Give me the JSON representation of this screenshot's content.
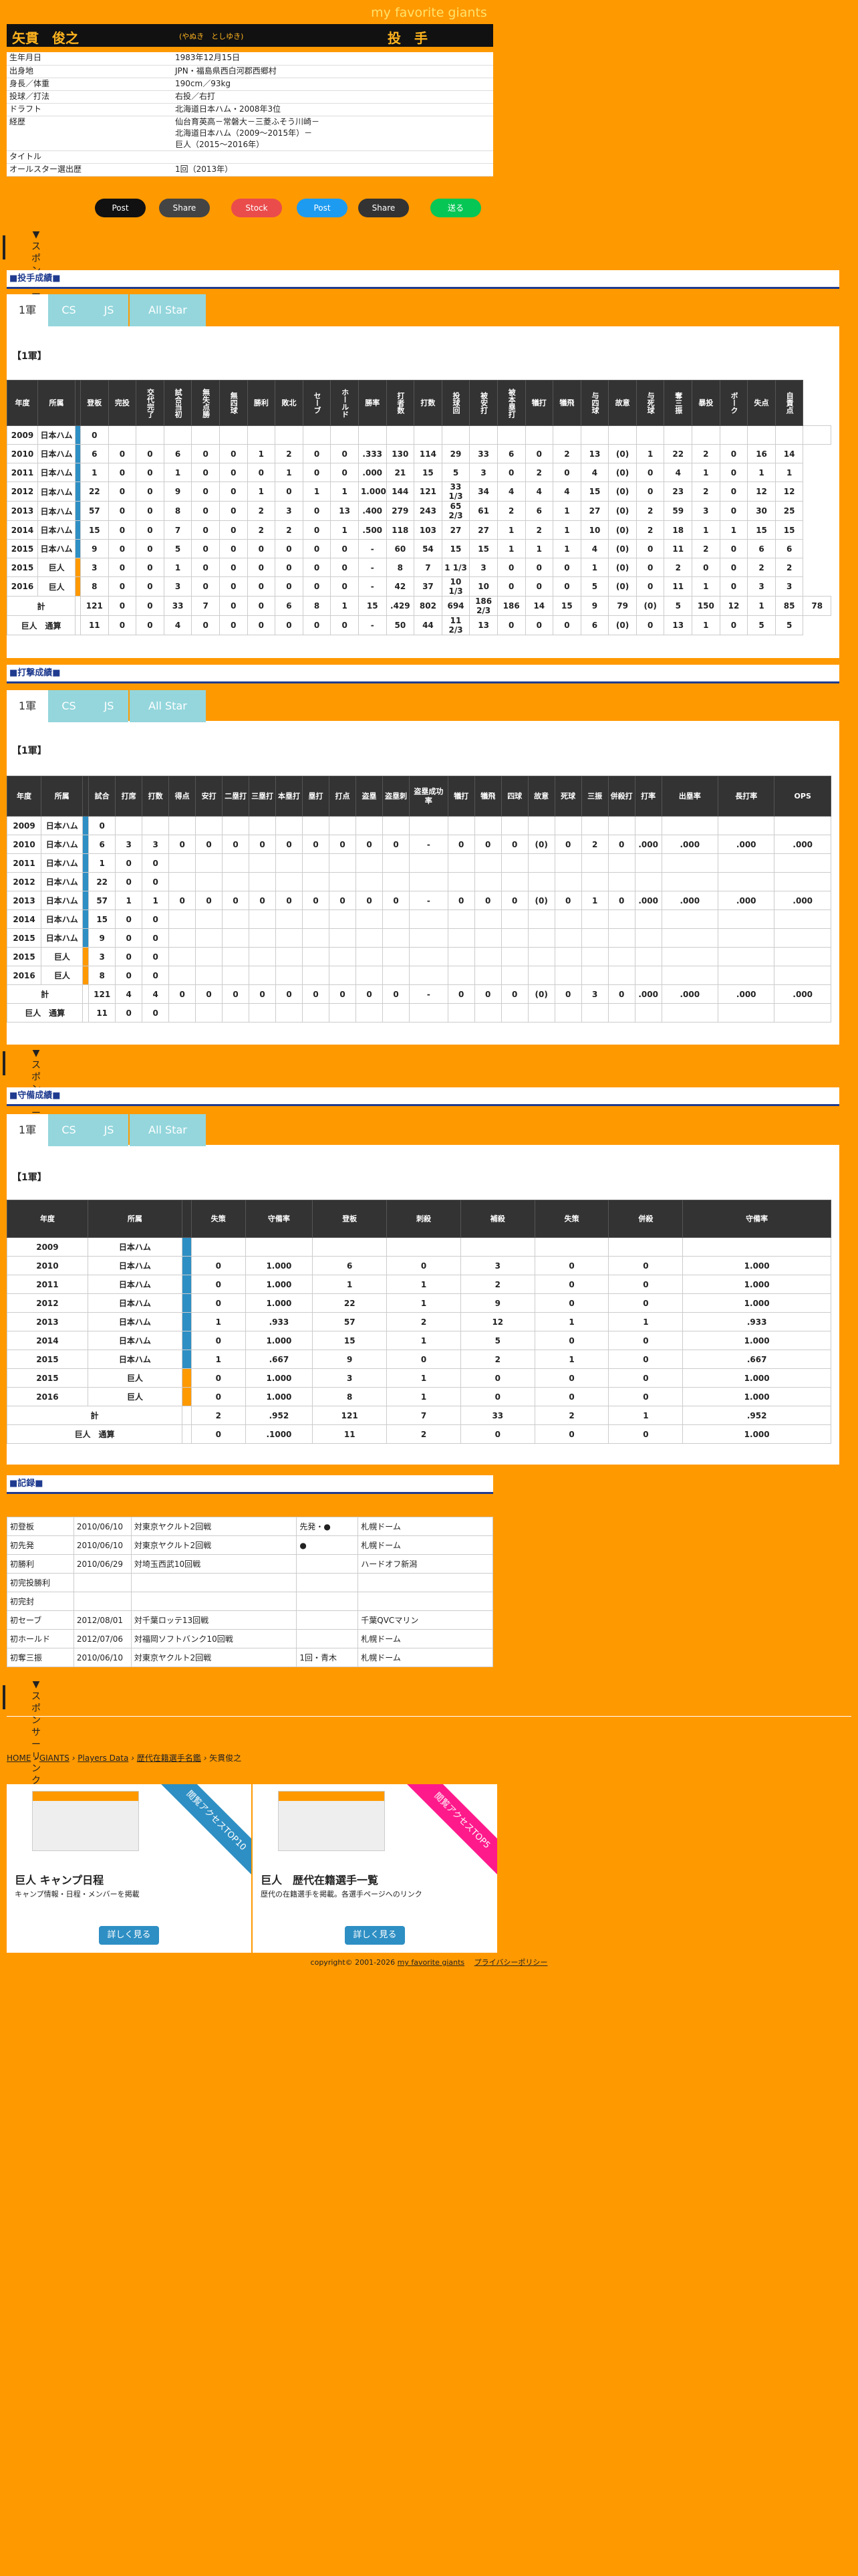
{
  "site_title": "my favorite giants",
  "player": {
    "name": "矢貫　俊之",
    "kana": "(やぬき　としゆき)",
    "position": "投　手"
  },
  "profile": [
    [
      "生年月日",
      "1983年12月15日"
    ],
    [
      "出身地",
      "JPN・福島県西白河郡西郷村"
    ],
    [
      "身長／体重",
      "190cm／93kg"
    ],
    [
      "投球／打法",
      "右投／右打"
    ],
    [
      "ドラフト",
      "北海道日本ハム・2008年3位"
    ],
    [
      "経歴",
      "仙台育英高－常磐大－三菱ふそう川崎－\n北海道日本ハム（2009～2015年）－\n巨人（2015～2016年）"
    ],
    [
      "タイトル",
      ""
    ],
    [
      "オールスター選出歴",
      "1回（2013年）"
    ]
  ],
  "share": [
    "Post",
    "Share",
    "Stock",
    "Post",
    "Share",
    "送る"
  ],
  "sponsor": "▼スポンサーリンク",
  "sections": {
    "pitching": "■投手成績■",
    "batting": "■打撃成績■",
    "fielding": "■守備成績■",
    "record": "■記録■"
  },
  "tabs": [
    "1軍",
    "CS",
    "JS",
    "All Star"
  ],
  "tier_label": "【1軍】",
  "pitch_headers": [
    "年度",
    "所属",
    "",
    "登板",
    "完投",
    "交代完了",
    "試合当初",
    "無失点勝",
    "無四球",
    "勝利",
    "敗北",
    "セーブ",
    "ホールド",
    "勝率",
    "打者数",
    "打数",
    "投球回",
    "被安打",
    "被本塁打",
    "犠打",
    "犠飛",
    "与四球",
    "故意",
    "与死球",
    "奪三振",
    "暴投",
    "ボーク",
    "失点",
    "自責点"
  ],
  "pitch_rows": [
    [
      "2009",
      "日本ハム",
      "0",
      "",
      "",
      "",
      "",
      "",
      "",
      "",
      "",
      "",
      "",
      "",
      "",
      "",
      "",
      "",
      "",
      "",
      "",
      "",
      "",
      "",
      "",
      "",
      "",
      "",
      ""
    ],
    [
      "2010",
      "日本ハム",
      "6",
      "0",
      "0",
      "6",
      "0",
      "0",
      "1",
      "2",
      "0",
      "0",
      ".333",
      "130",
      "114",
      "29",
      "33",
      "6",
      "0",
      "2",
      "13",
      "(0)",
      "1",
      "22",
      "2",
      "0",
      "16",
      "14"
    ],
    [
      "2011",
      "日本ハム",
      "1",
      "0",
      "0",
      "1",
      "0",
      "0",
      "0",
      "1",
      "0",
      "0",
      ".000",
      "21",
      "15",
      "5",
      "3",
      "0",
      "2",
      "0",
      "4",
      "(0)",
      "0",
      "4",
      "1",
      "0",
      "1",
      "1"
    ],
    [
      "2012",
      "日本ハム",
      "22",
      "0",
      "0",
      "9",
      "0",
      "0",
      "1",
      "0",
      "1",
      "1",
      "1.000",
      "144",
      "121",
      "33 1/3",
      "34",
      "4",
      "4",
      "4",
      "15",
      "(0)",
      "0",
      "23",
      "2",
      "0",
      "12",
      "12"
    ],
    [
      "2013",
      "日本ハム",
      "57",
      "0",
      "0",
      "8",
      "0",
      "0",
      "2",
      "3",
      "0",
      "13",
      ".400",
      "279",
      "243",
      "65 2/3",
      "61",
      "2",
      "6",
      "1",
      "27",
      "(0)",
      "2",
      "59",
      "3",
      "0",
      "30",
      "25"
    ],
    [
      "2014",
      "日本ハム",
      "15",
      "0",
      "0",
      "7",
      "0",
      "0",
      "2",
      "2",
      "0",
      "1",
      ".500",
      "118",
      "103",
      "27",
      "27",
      "1",
      "2",
      "1",
      "10",
      "(0)",
      "2",
      "18",
      "1",
      "1",
      "15",
      "15"
    ],
    [
      "2015",
      "日本ハム",
      "9",
      "0",
      "0",
      "5",
      "0",
      "0",
      "0",
      "0",
      "0",
      "0",
      "-",
      "60",
      "54",
      "15",
      "15",
      "1",
      "1",
      "1",
      "4",
      "(0)",
      "0",
      "11",
      "2",
      "0",
      "6",
      "6"
    ],
    [
      "2015",
      "巨人",
      "3",
      "0",
      "0",
      "1",
      "0",
      "0",
      "0",
      "0",
      "0",
      "0",
      "-",
      "8",
      "7",
      "1 1/3",
      "3",
      "0",
      "0",
      "0",
      "1",
      "(0)",
      "0",
      "2",
      "0",
      "0",
      "2",
      "2"
    ],
    [
      "2016",
      "巨人",
      "8",
      "0",
      "0",
      "3",
      "0",
      "0",
      "0",
      "0",
      "0",
      "0",
      "-",
      "42",
      "37",
      "10 1/3",
      "10",
      "0",
      "0",
      "0",
      "5",
      "(0)",
      "0",
      "11",
      "1",
      "0",
      "3",
      "3"
    ],
    [
      "計",
      "",
      "121",
      "0",
      "0",
      "33",
      "7",
      "0",
      "0",
      "6",
      "8",
      "1",
      "15",
      ".429",
      "802",
      "694",
      "186 2/3",
      "186",
      "14",
      "15",
      "9",
      "79",
      "(0)",
      "5",
      "150",
      "12",
      "1",
      "85",
      "78"
    ],
    [
      "巨人　通算",
      "",
      "11",
      "0",
      "0",
      "4",
      "0",
      "0",
      "0",
      "0",
      "0",
      "0",
      "-",
      "50",
      "44",
      "11 2/3",
      "13",
      "0",
      "0",
      "0",
      "6",
      "(0)",
      "0",
      "13",
      "1",
      "0",
      "5",
      "5"
    ]
  ],
  "bat_headers": [
    "年度",
    "所属",
    "",
    "試合",
    "打席",
    "打数",
    "得点",
    "安打",
    "二塁打",
    "三塁打",
    "本塁打",
    "塁打",
    "打点",
    "盗塁",
    "盗塁刺",
    "盗塁成功率",
    "犠打",
    "犠飛",
    "四球",
    "故意",
    "死球",
    "三振",
    "併殺打",
    "打率",
    "出塁率",
    "長打率",
    "OPS"
  ],
  "bat_rows": [
    [
      "2009",
      "日本ハム",
      "0"
    ],
    [
      "2010",
      "日本ハム",
      "6",
      "3",
      "3",
      "0",
      "0",
      "0",
      "0",
      "0",
      "0",
      "0",
      "0",
      "0",
      "-",
      "0",
      "0",
      "0",
      "(0)",
      "0",
      "2",
      "0",
      ".000",
      ".000",
      ".000",
      ".000"
    ],
    [
      "2011",
      "日本ハム",
      "1",
      "0",
      "0"
    ],
    [
      "2012",
      "日本ハム",
      "22",
      "0",
      "0"
    ],
    [
      "2013",
      "日本ハム",
      "57",
      "1",
      "1",
      "0",
      "0",
      "0",
      "0",
      "0",
      "0",
      "0",
      "0",
      "0",
      "-",
      "0",
      "0",
      "0",
      "(0)",
      "0",
      "1",
      "0",
      ".000",
      ".000",
      ".000",
      ".000"
    ],
    [
      "2014",
      "日本ハム",
      "15",
      "0",
      "0"
    ],
    [
      "2015",
      "日本ハム",
      "9",
      "0",
      "0"
    ],
    [
      "2015",
      "巨人",
      "3",
      "0",
      "0"
    ],
    [
      "2016",
      "巨人",
      "8",
      "0",
      "0"
    ],
    [
      "計",
      "",
      "121",
      "4",
      "4",
      "0",
      "0",
      "0",
      "0",
      "0",
      "0",
      "0",
      "0",
      "0",
      "-",
      "0",
      "0",
      "0",
      "(0)",
      "0",
      "3",
      "0",
      ".000",
      ".000",
      ".000",
      ".000"
    ],
    [
      "巨人　通算",
      "",
      "11",
      "0",
      "0"
    ]
  ],
  "field_headers": [
    "年度",
    "所属",
    "",
    "失策",
    "守備率",
    "登板",
    "刺殺",
    "補殺",
    "失策",
    "併殺",
    "守備率"
  ],
  "field_group": "投手",
  "field_rows": [
    [
      "2009",
      "日本ハム",
      "",
      "",
      "",
      "",
      "",
      "",
      "",
      ""
    ],
    [
      "2010",
      "日本ハム",
      "0",
      "1.000",
      "6",
      "0",
      "3",
      "0",
      "0",
      "1.000"
    ],
    [
      "2011",
      "日本ハム",
      "0",
      "1.000",
      "1",
      "1",
      "2",
      "0",
      "0",
      "1.000"
    ],
    [
      "2012",
      "日本ハム",
      "0",
      "1.000",
      "22",
      "1",
      "9",
      "0",
      "0",
      "1.000"
    ],
    [
      "2013",
      "日本ハム",
      "1",
      ".933",
      "57",
      "2",
      "12",
      "1",
      "1",
      ".933"
    ],
    [
      "2014",
      "日本ハム",
      "0",
      "1.000",
      "15",
      "1",
      "5",
      "0",
      "0",
      "1.000"
    ],
    [
      "2015",
      "日本ハム",
      "1",
      ".667",
      "9",
      "0",
      "2",
      "1",
      "0",
      ".667"
    ],
    [
      "2015",
      "巨人",
      "0",
      "1.000",
      "3",
      "1",
      "0",
      "0",
      "0",
      "1.000"
    ],
    [
      "2016",
      "巨人",
      "0",
      "1.000",
      "8",
      "1",
      "0",
      "0",
      "0",
      "1.000"
    ],
    [
      "計",
      "",
      "2",
      ".952",
      "121",
      "7",
      "33",
      "2",
      "1",
      ".952"
    ],
    [
      "巨人　通算",
      "",
      "0",
      ".1000",
      "11",
      "2",
      "0",
      "0",
      "0",
      "1.000"
    ]
  ],
  "records": [
    [
      "初登板",
      "2010/06/10",
      "対東京ヤクルト2回戦",
      "先発・●",
      "札幌ドーム"
    ],
    [
      "初先発",
      "2010/06/10",
      "対東京ヤクルト2回戦",
      "●",
      "札幌ドーム"
    ],
    [
      "初勝利",
      "2010/06/29",
      "対埼玉西武10回戦",
      "",
      "ハードオフ新潟"
    ],
    [
      "初完投勝利",
      "",
      "",
      "",
      ""
    ],
    [
      "初完封",
      "",
      "",
      "",
      ""
    ],
    [
      "初セーブ",
      "2012/08/01",
      "対千葉ロッテ13回戦",
      "",
      "千葉QVCマリン"
    ],
    [
      "初ホールド",
      "2012/07/06",
      "対福岡ソフトバンク10回戦",
      "",
      "札幌ドーム"
    ],
    [
      "初奪三振",
      "2010/06/10",
      "対東京ヤクルト2回戦",
      "1回・青木",
      "札幌ドーム"
    ]
  ],
  "breadcrumb": [
    "HOME",
    "GIANTS",
    "Players Data",
    "歴代在籍選手名鑑",
    "矢貫俊之"
  ],
  "cards": [
    {
      "ribbon": "閲覧アクセスTOP10",
      "title": "巨人 キャンプ日程",
      "desc": "キャンプ情報・日程・メンバーを掲載",
      "button": "詳しく見る"
    },
    {
      "ribbon": "閲覧アクセスTOP5",
      "title": "巨人　歴代在籍選手一覧",
      "desc": "歴代の在籍選手を掲載。各選手ページへのリンク",
      "button": "詳しく見る"
    }
  ],
  "copyright": "copyright© 2001-2026",
  "footer_links": [
    "my favorite giants",
    "プライバシーポリシー"
  ],
  "colors": {
    "bg": "#ff9900",
    "header": "#111111",
    "accent": "#ffb41e",
    "tab": "#94d6dc",
    "bar_blue": "#2e8fc4"
  }
}
